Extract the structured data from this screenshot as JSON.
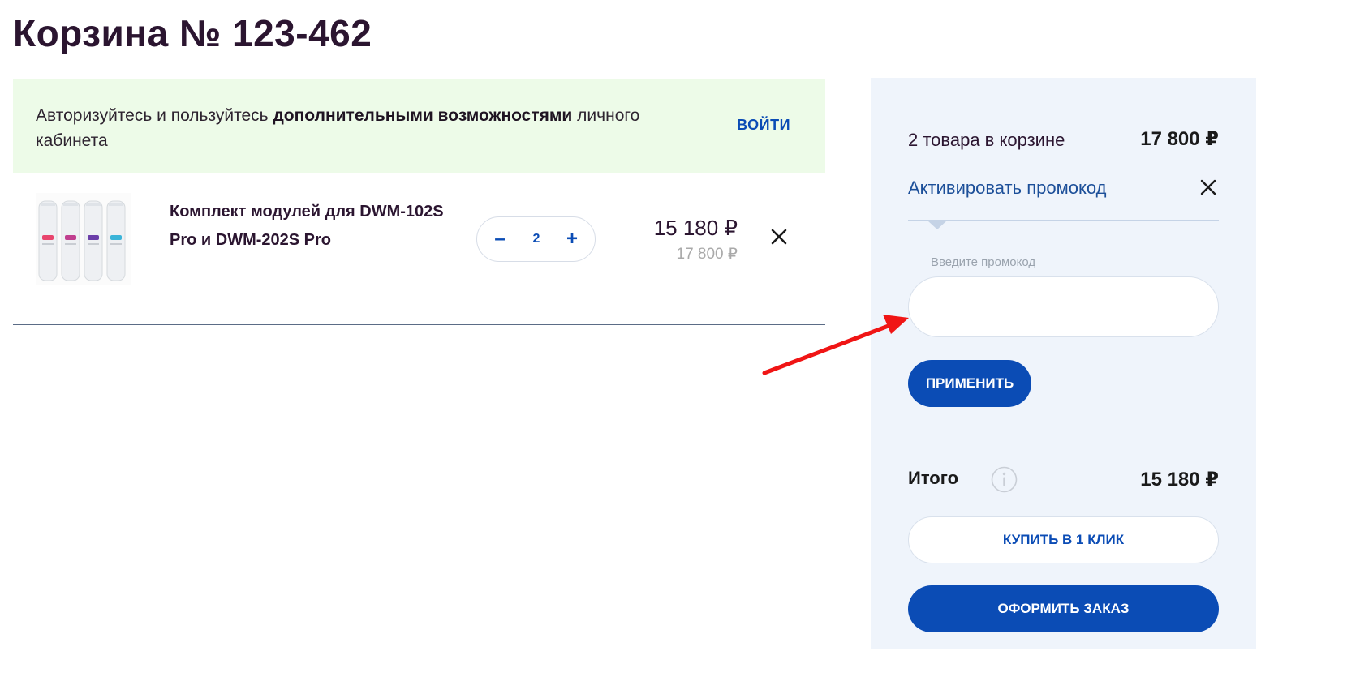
{
  "page": {
    "title": "Корзина № 123-462"
  },
  "banner": {
    "text_before": "Авторизуйтесь и пользуйтесь ",
    "text_bold": "дополнительными возможностями",
    "text_after": " личного кабинета",
    "login_label": "ВОЙТИ"
  },
  "cart": {
    "items": [
      {
        "name": "Комплект модулей для DWM-102S Pro и DWM-202S Pro",
        "quantity": "2",
        "price_current": "15 180 ₽",
        "price_old": "17 800 ₽",
        "minus_label": "–",
        "plus_label": "+"
      }
    ]
  },
  "summary": {
    "count_text": "2 товара в корзине",
    "count_total": "17 800 ₽",
    "promo_link": "Активировать промокод",
    "promo_label": "Введите промокод",
    "promo_value": "",
    "apply_label": "ПРИМЕНИТЬ",
    "total_label": "Итого",
    "total_value": "15 180 ₽",
    "one_click_label": "КУПИТЬ В 1 КЛИК",
    "checkout_label": "ОФОРМИТЬ ЗАКАЗ"
  },
  "colors": {
    "accent": "#0b4cb5",
    "banner_bg": "#edfbe8",
    "sidebar_bg": "#eff4fb",
    "annotation_arrow": "#f01515"
  },
  "icons": {
    "remove": "close-icon",
    "promo_close": "close-icon",
    "info": "info-icon",
    "annotation": "red-arrow-icon"
  }
}
